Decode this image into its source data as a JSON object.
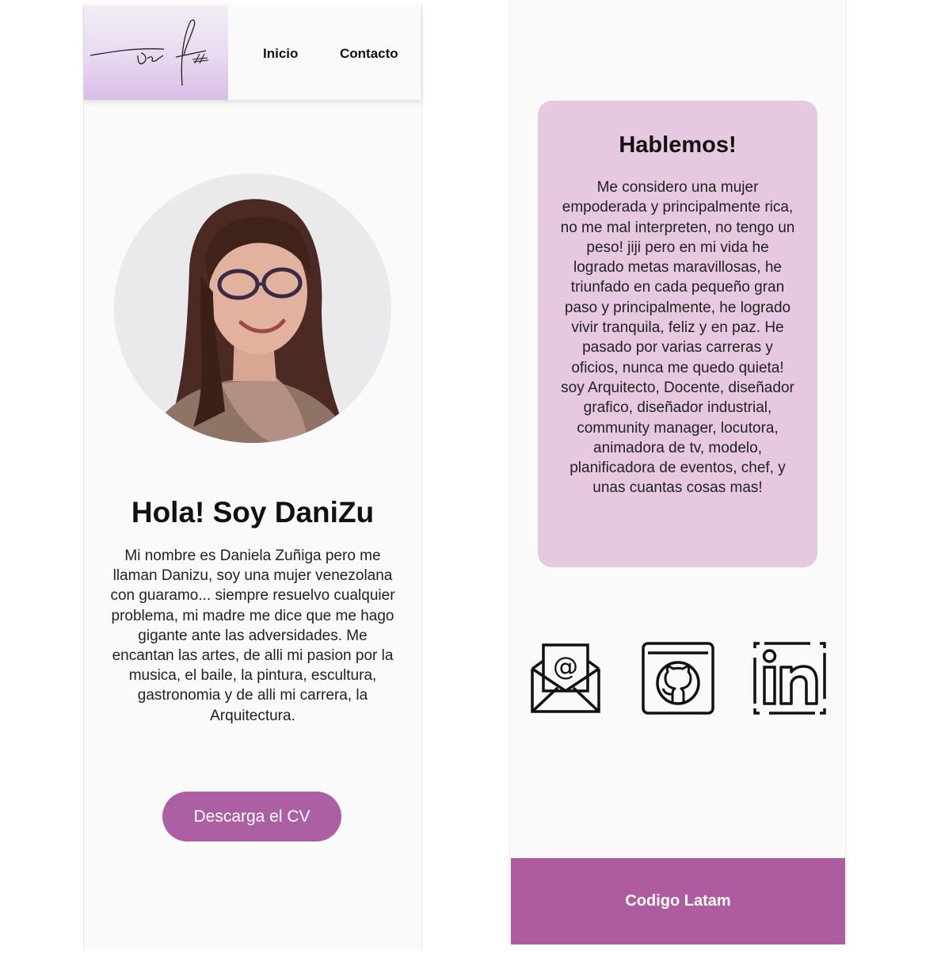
{
  "header": {
    "nav": {
      "inicio": "Inicio",
      "contacto": "Contacto"
    }
  },
  "hero": {
    "title": "Hola! Soy DaniZu",
    "bio": "Mi nombre es Daniela Zuñiga pero me llaman Danizu, soy una mujer venezolana con guaramo... siempre resuelvo cualquier problema, mi madre me dice que me hago gigante ante las adversidades. Me encantan las artes, de alli mi pasion por la musica, el baile, la pintura, escultura, gastronomia y de alli mi carrera, la Arquitectura.",
    "cv_button": "Descarga el CV"
  },
  "contact": {
    "title": "Hablemos!",
    "text": "Me considero una mujer empoderada y principalmente rica, no me mal interpreten, no tengo un peso! jiji pero en mi vida he logrado metas maravillosas, he triunfado en cada pequeño gran paso y principalmente, he logrado vivir tranquila, feliz y en paz. He pasado por varias carreras y oficios, nunca me quedo quieta! soy Arquitecto, Docente, diseñador grafico, diseñador industrial, community manager, locutora, animadora de tv, modelo, planificadora de eventos, chef, y unas cuantas cosas mas!"
  },
  "social": [
    "email-icon",
    "github-icon",
    "linkedin-icon"
  ],
  "footer": {
    "text": "Codigo Latam"
  },
  "colors": {
    "accent": "#ad5fa3",
    "card": "#e6c9e0",
    "footer": "#af5b9f",
    "logo_bg": "#e3d0ec"
  }
}
